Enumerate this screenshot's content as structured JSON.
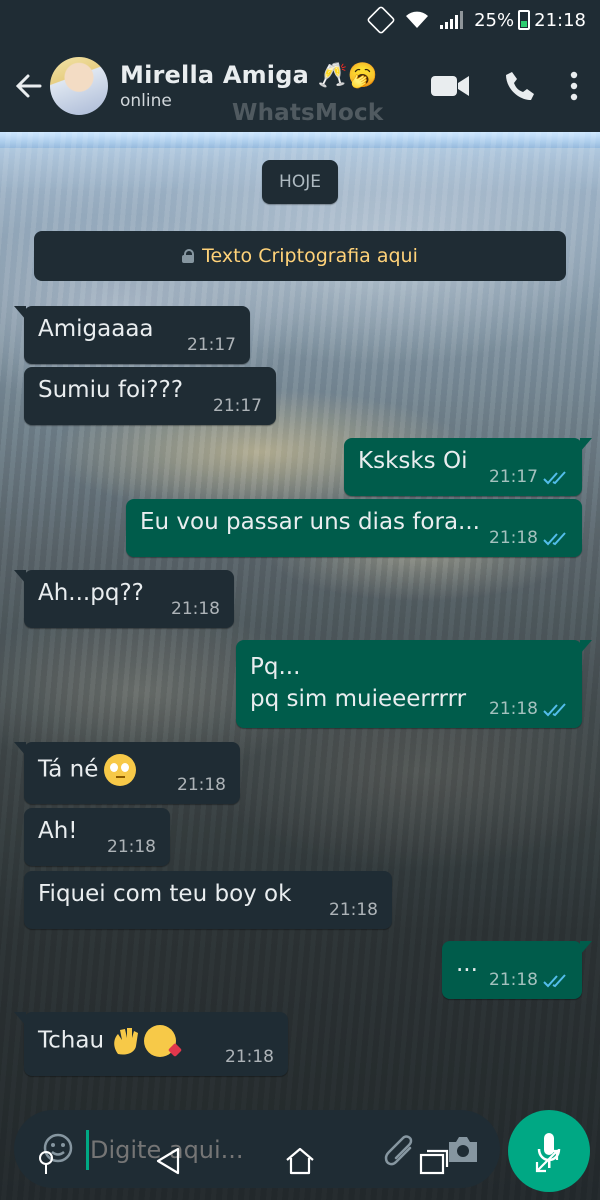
{
  "status_bar": {
    "battery": "25%",
    "time": "21:18"
  },
  "header": {
    "contact_name": "Mirella Amiga 🥂🥱",
    "contact_status": "online",
    "watermark": "WhatsMock"
  },
  "chat": {
    "date_chip": "HOJE",
    "encryption_notice": "Texto Criptografia aqui",
    "messages": [
      {
        "direction": "in",
        "text": "Amigaaaa",
        "time": "21:17"
      },
      {
        "direction": "in",
        "text": "Sumiu foi???",
        "time": "21:17"
      },
      {
        "direction": "out",
        "text": "Ksksks Oi",
        "time": "21:17",
        "read": true
      },
      {
        "direction": "out",
        "text": "Eu vou passar uns dias fora...",
        "time": "21:18",
        "read": true
      },
      {
        "direction": "in",
        "text": "Ah...pq??",
        "time": "21:18"
      },
      {
        "direction": "out",
        "text_line1": "Pq...",
        "text_line2": "pq sim muieeerrrrr",
        "time": "21:18",
        "read": true
      },
      {
        "direction": "in",
        "text": "Tá né",
        "emoji": "face-with-rolling-eyes-icon",
        "time": "21:18"
      },
      {
        "direction": "in",
        "text": "Ah!",
        "time": "21:18"
      },
      {
        "direction": "in",
        "text": "Fiquei com teu boy ok",
        "time": "21:18"
      },
      {
        "direction": "out",
        "text": "...",
        "time": "21:18",
        "read": true
      },
      {
        "direction": "in",
        "text": "Tchau",
        "emoji": "waving-hand-and-kiss-face-icons",
        "time": "21:18"
      }
    ]
  },
  "composer": {
    "placeholder": "Digite aqui..."
  },
  "colors": {
    "header_bg": "#1f2c34",
    "incoming_bubble": "#1f2c34",
    "outgoing_bubble": "#005c4b",
    "accent": "#00a884",
    "read_tick": "#53bdeb",
    "encryption_text": "#ffd279"
  }
}
